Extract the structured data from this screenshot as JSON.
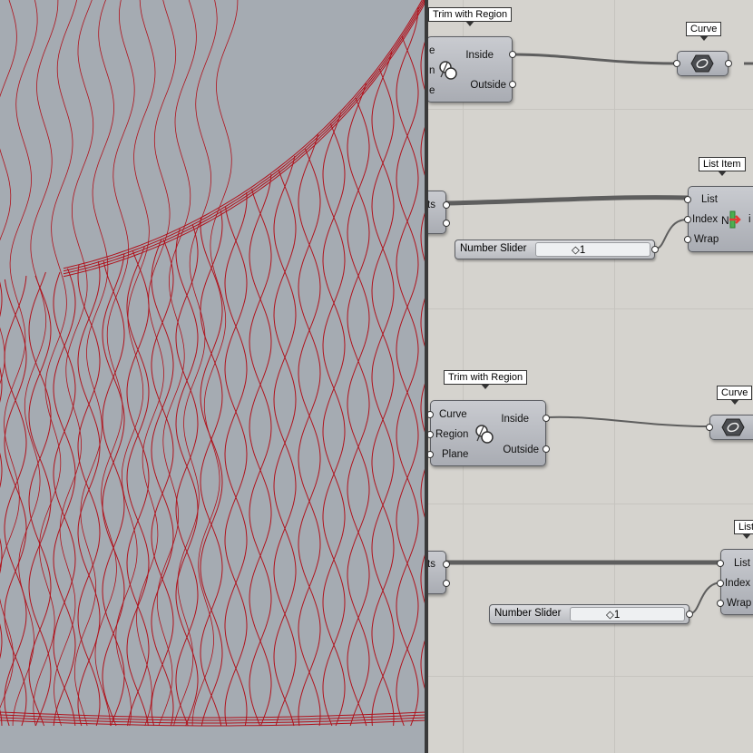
{
  "components": {
    "trim1": {
      "title": "Trim with Region",
      "inputs": [
        "e",
        "n",
        "e"
      ],
      "outputs": [
        "Inside",
        "Outside"
      ]
    },
    "curve1": {
      "title": "Curve"
    },
    "list1": {
      "title": "List Item",
      "inputs": [
        "List",
        "Index",
        "Wrap"
      ],
      "right_glyph": "i"
    },
    "partial1": {
      "outputs": [
        "ts"
      ]
    },
    "slider1": {
      "label": "Number Slider",
      "value": "1"
    },
    "trim2": {
      "title": "Trim with Region",
      "inputs": [
        "Curve",
        "Region",
        "Plane"
      ],
      "outputs": [
        "Inside",
        "Outside"
      ]
    },
    "curve2": {
      "title": "Curve"
    },
    "list2": {
      "title": "List",
      "inputs": [
        "List",
        "Index",
        "Wrap"
      ]
    },
    "partial2": {
      "outputs": [
        "ts"
      ]
    },
    "slider2": {
      "label": "Number Slider",
      "value": "1"
    }
  },
  "icons": {
    "trim": "trim-region-icon",
    "curve": "curve-param-icon",
    "list": "list-item-icon"
  },
  "colors": {
    "viewport_bg": "#a5abb2",
    "curve_red": "#b0111b",
    "canvas_bg": "#d5d3ce",
    "wire": "#5e5e5e"
  }
}
